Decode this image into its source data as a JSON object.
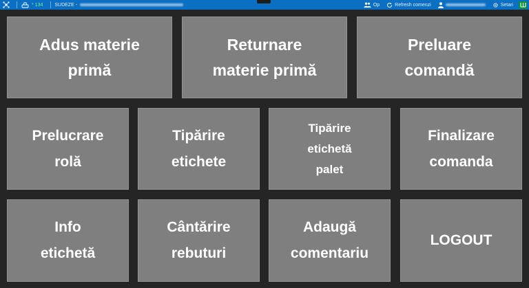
{
  "topbar": {
    "count": "* 134",
    "session_label": "SUDEZE -",
    "items": {
      "users": "Op",
      "refresh": "Refresh comenzi",
      "settings": "Setari"
    }
  },
  "tiles": {
    "adus_materie_prima": "Adus materie\nprimă",
    "returnare_materie_prima": "Returnare\nmaterie primă",
    "preluare_comanda": "Preluare\ncomandă",
    "prelucrare_rola": "Prelucrare\nrolă",
    "tiparire_etichete": "Tipărire\netichete",
    "tiparire_eticheta_palet": "Tipărire\netichetă\npalet",
    "finalizare_comanda": "Finalizare\ncomanda",
    "info_eticheta": "Info\netichetă",
    "cantarire_rebuturi": "Cântărire\nrebuturi",
    "adauga_comentariu": "Adaugă\ncomentariu",
    "logout": "LOGOUT"
  },
  "colors": {
    "topbar": "#0b6fc3",
    "background": "#252525",
    "tile": "#7f7f7f",
    "count_text": "#7cf28a",
    "brand": "#0a8f3a"
  }
}
